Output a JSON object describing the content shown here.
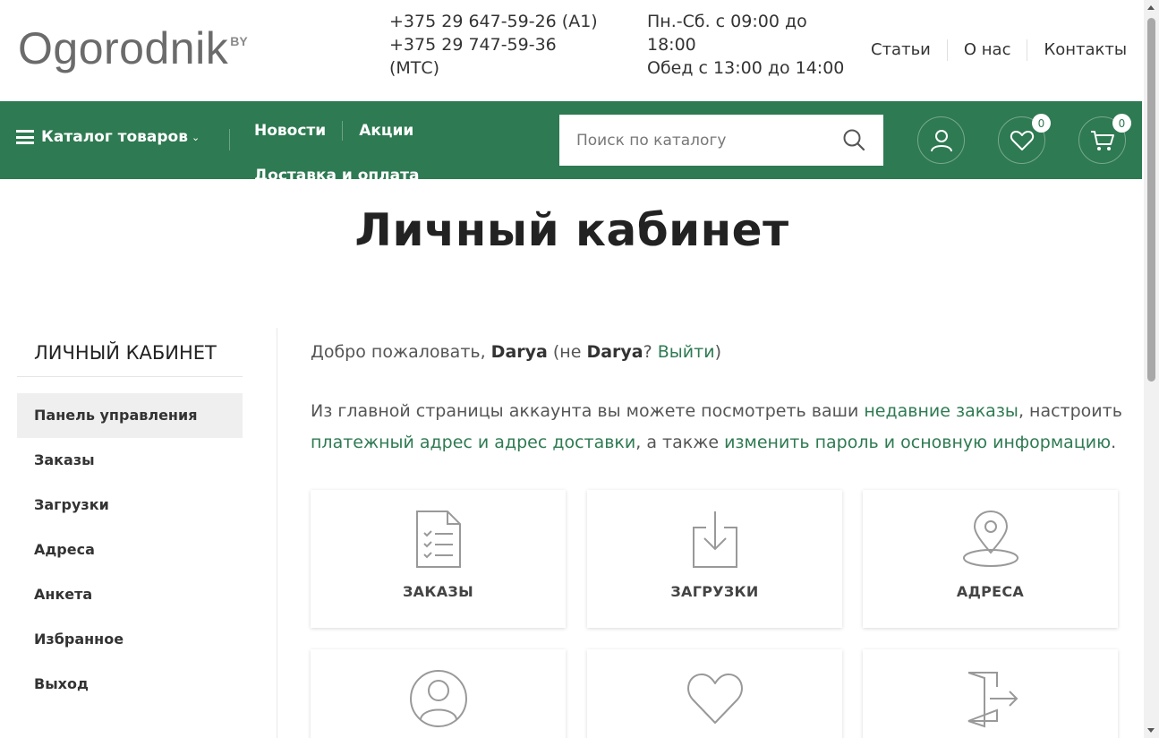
{
  "header": {
    "logo_text": "Ogorodnik",
    "logo_suffix": "BY",
    "phones": [
      "+375 29 647-59-26 (A1)",
      "+375 29 747-59-36 (МТС)"
    ],
    "hours_line1": "Пн.-Сб. с 09:00 до 18:00",
    "hours_line2": "Обед с 13:00 до 14:00",
    "links": [
      "Статьи",
      "О нас",
      "Контакты"
    ]
  },
  "nav": {
    "catalog_label": "Каталог товаров",
    "links_row1": [
      "Новости",
      "Акции"
    ],
    "links_row2": [
      "Доставка и оплата"
    ],
    "search_placeholder": "Поиск по каталогу",
    "wishlist_count": "0",
    "cart_count": "0"
  },
  "page": {
    "title": "Личный кабинет"
  },
  "sidebar": {
    "heading": "ЛИЧНЫЙ КАБИНЕТ",
    "items": [
      "Панель управления",
      "Заказы",
      "Загрузки",
      "Адреса",
      "Анкета",
      "Избранное",
      "Выход"
    ],
    "active_index": 0
  },
  "main": {
    "welcome_prefix": "Добро пожаловать, ",
    "user_name": "Darya",
    "welcome_mid": " (не ",
    "welcome_q": "? ",
    "logout_link": "Выйти",
    "welcome_suffix": ")",
    "intro_part1": "Из главной страницы аккаунта вы можете посмотреть ваши ",
    "intro_link1": "недавние заказы",
    "intro_part2": ", настроить ",
    "intro_link2": "платежный адрес и адрес доставки",
    "intro_part3": ", а также ",
    "intro_link3": "изменить пароль и основную информацию",
    "intro_part4": ".",
    "cards": [
      {
        "label": "ЗАКАЗЫ",
        "icon": "orders-icon"
      },
      {
        "label": "ЗАГРУЗКИ",
        "icon": "download-icon"
      },
      {
        "label": "АДРЕСА",
        "icon": "location-pin-icon"
      },
      {
        "label": "",
        "icon": "user-profile-icon"
      },
      {
        "label": "",
        "icon": "heart-icon"
      },
      {
        "label": "",
        "icon": "logout-door-icon"
      }
    ]
  },
  "colors": {
    "brand_green": "#2e7a52",
    "logo_red": "#c0392b"
  }
}
